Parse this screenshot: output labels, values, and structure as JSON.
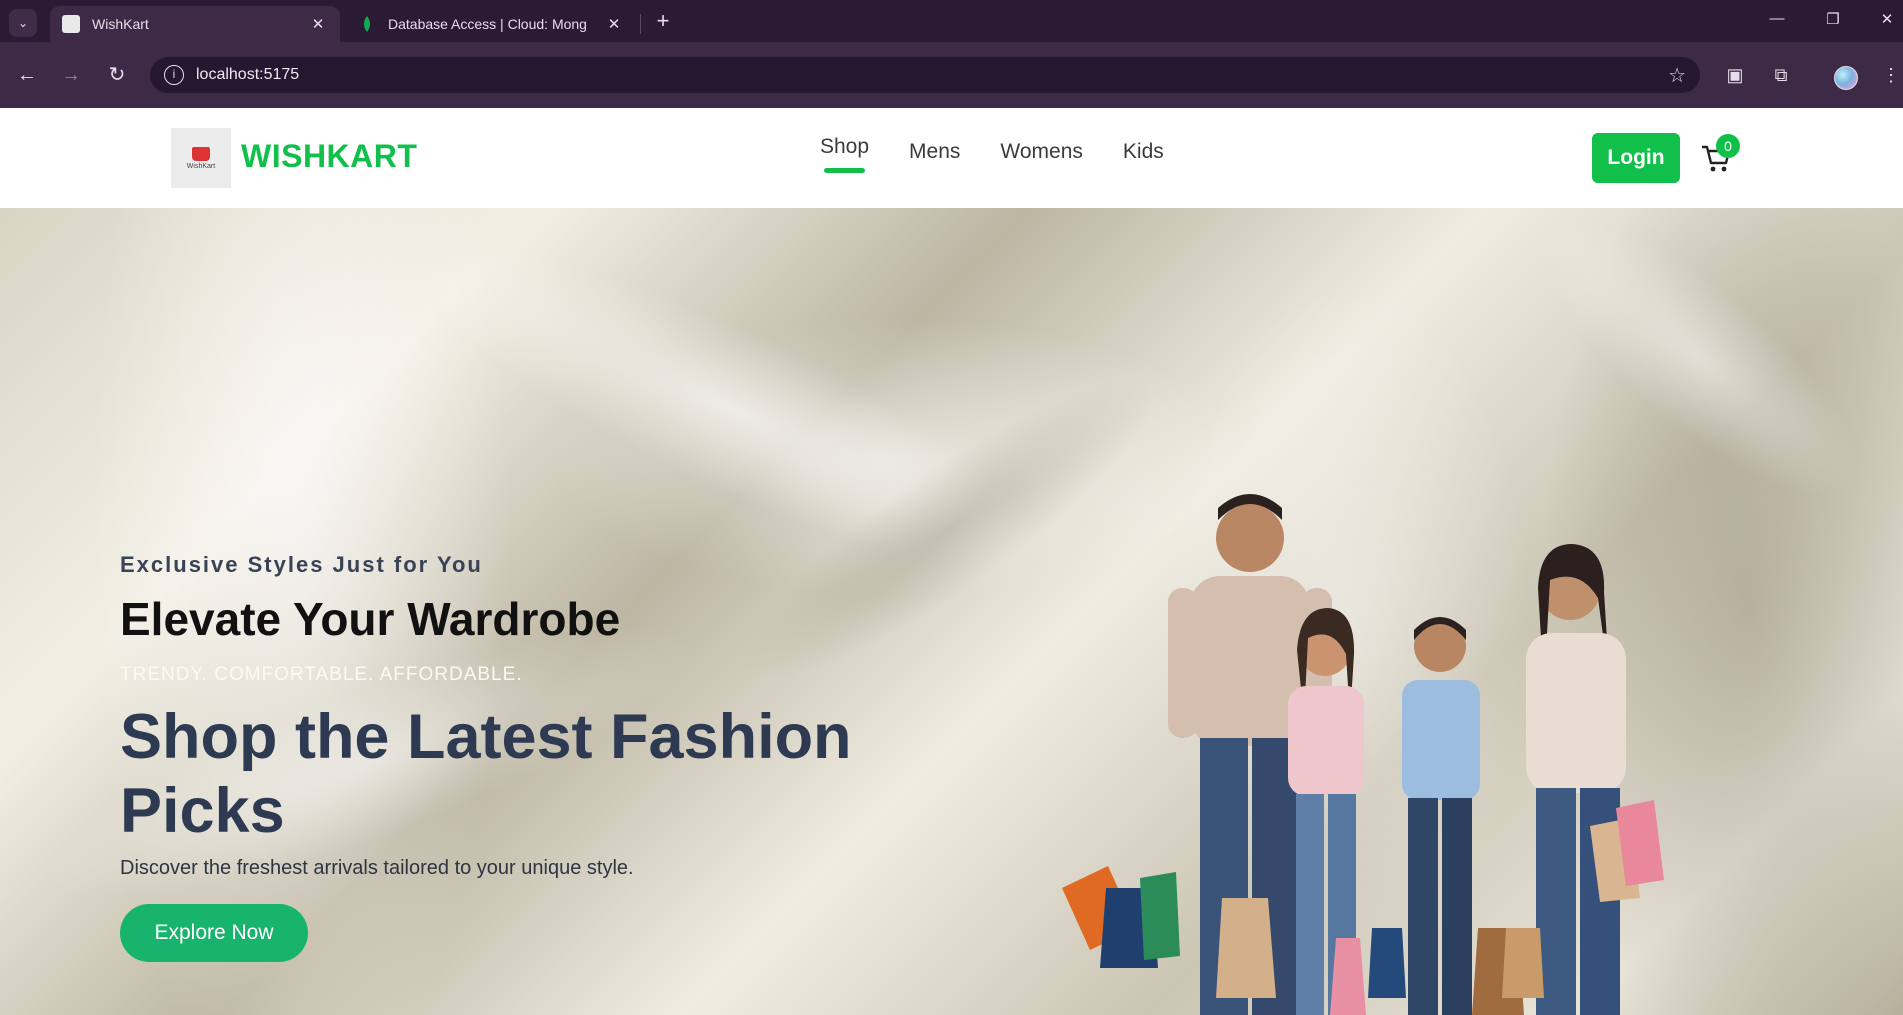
{
  "browser": {
    "tabs": [
      {
        "title": "WishKart",
        "active": true
      },
      {
        "title": "Database Access | Cloud: Mong",
        "active": false
      }
    ],
    "url": "localhost:5175"
  },
  "header": {
    "logo_mini_text": "WishKart",
    "brand": "WISHKART",
    "nav": [
      "Shop",
      "Mens",
      "Womens",
      "Kids"
    ],
    "active_nav": "Shop",
    "login_label": "Login",
    "cart_count": "0"
  },
  "hero": {
    "eyebrow": "Exclusive Styles Just for You",
    "title": "Elevate Your Wardrobe",
    "tagline": "TRENDY. COMFORTABLE. AFFORDABLE.",
    "headline": "Shop the Latest Fashion Picks",
    "description": "Discover the freshest arrivals tailored to your unique style.",
    "cta_label": "Explore Now"
  },
  "colors": {
    "brand_green": "#10c04a",
    "cta_green": "#18b36d",
    "chrome_bg": "#2b1a33"
  }
}
